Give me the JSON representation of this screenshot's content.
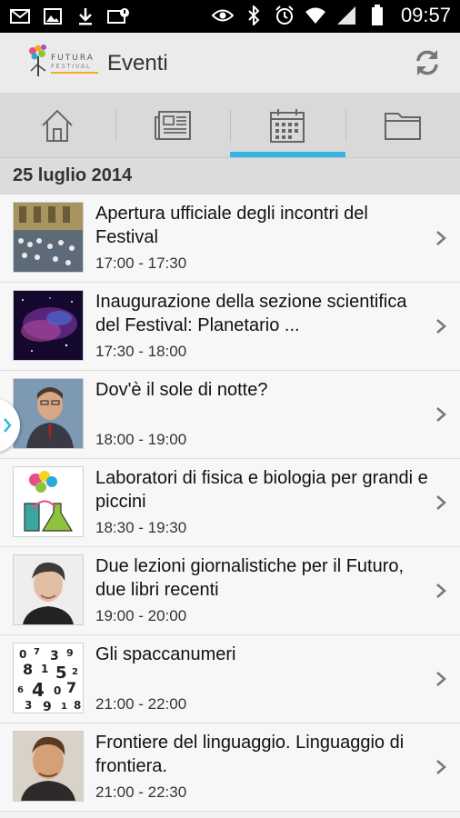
{
  "status_bar": {
    "time": "09:57",
    "left_icons": [
      "mail-icon",
      "image-icon",
      "download-icon",
      "photo-error-icon"
    ],
    "right_icons": [
      "eye-icon",
      "bluetooth-icon",
      "alarm-icon",
      "wifi-icon",
      "signal-icon",
      "battery-icon"
    ]
  },
  "action_bar": {
    "logo_text": "FUTURA FESTIVAL",
    "title": "Eventi",
    "refresh_icon": "refresh-icon"
  },
  "tabs": [
    {
      "icon": "home-icon",
      "active": false
    },
    {
      "icon": "news-icon",
      "active": false
    },
    {
      "icon": "calendar-icon",
      "active": true
    },
    {
      "icon": "folder-icon",
      "active": false
    }
  ],
  "accent_color": "#33b5e5",
  "date_header": "25 luglio 2014",
  "events": [
    {
      "title": "Apertura ufficiale degli incontri del Festival",
      "time": "17:00 - 17:30"
    },
    {
      "title": "Inaugurazione della sezione scientifica del Festival: Planetario ...",
      "time": "17:30 - 18:00"
    },
    {
      "title": "Dov'è il sole di notte?",
      "time": "18:00 - 19:00"
    },
    {
      "title": "Laboratori di fisica e biologia per grandi e piccini",
      "time": "18:30 - 19:30"
    },
    {
      "title": "Due lezioni giornalistiche per il Futuro, due libri recenti",
      "time": "19:00 - 20:00"
    },
    {
      "title": "Gli spaccanumeri",
      "time": "21:00 - 22:00"
    },
    {
      "title": "Frontiere del linguaggio. Linguaggio di frontiera.",
      "time": "21:00 - 22:30"
    }
  ]
}
